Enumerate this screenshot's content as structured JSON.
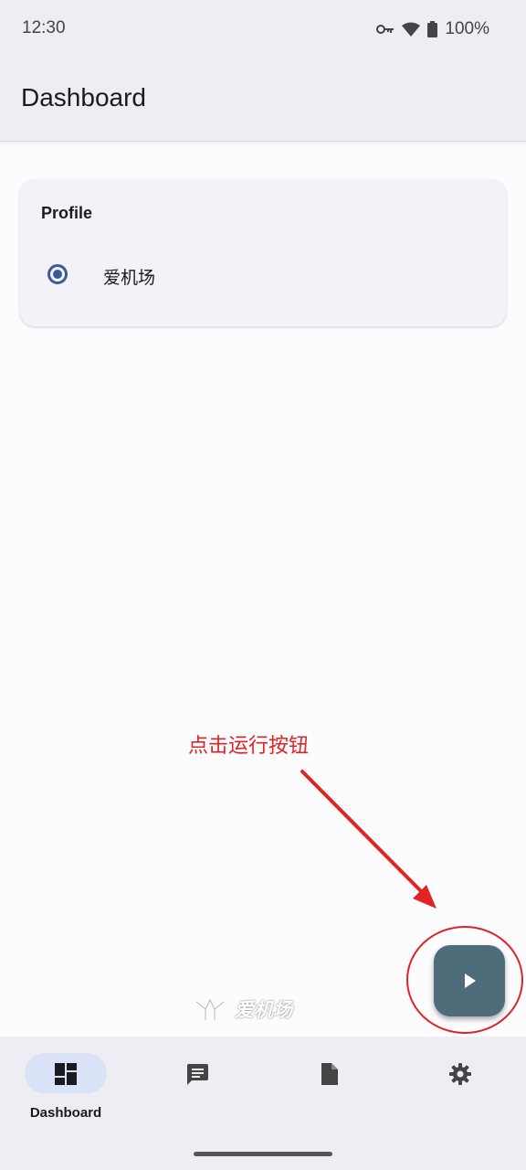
{
  "status_bar": {
    "time": "12:30",
    "battery_percent": "100%",
    "icons": [
      "vpn-key-icon",
      "wifi-icon",
      "battery-icon"
    ]
  },
  "app_bar": {
    "title": "Dashboard"
  },
  "profile_card": {
    "title": "Profile",
    "options": [
      {
        "label": "爱机场",
        "selected": true
      }
    ]
  },
  "annotation": {
    "text": "点击运行按钮",
    "color": "#e02424"
  },
  "fab": {
    "icon": "play-icon",
    "color": "#4f6c7b"
  },
  "watermark": {
    "text": "爱机场"
  },
  "bottom_nav": {
    "items": [
      {
        "label": "Dashboard",
        "icon": "dashboard-icon",
        "active": true
      },
      {
        "label": "",
        "icon": "message-icon",
        "active": false
      },
      {
        "label": "",
        "icon": "document-icon",
        "active": false
      },
      {
        "label": "",
        "icon": "gear-icon",
        "active": false
      }
    ]
  },
  "colors": {
    "accent": "#3e5a96",
    "nav_active_pill": "#d9e2f7",
    "surface": "#eeedf3"
  }
}
